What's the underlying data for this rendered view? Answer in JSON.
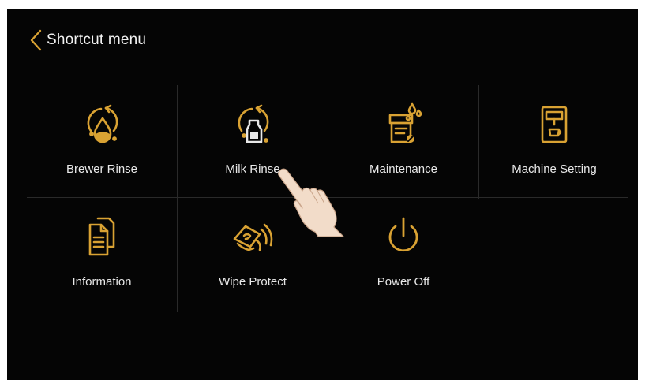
{
  "header": {
    "title": "Shortcut menu"
  },
  "colors": {
    "accent": "#d9a233",
    "background": "#050505",
    "text": "#e9e9e9"
  },
  "menu": {
    "items": [
      {
        "label": "Brewer Rinse",
        "icon": "brewer-rinse-icon"
      },
      {
        "label": "Milk Rinse",
        "icon": "milk-rinse-icon"
      },
      {
        "label": "Maintenance",
        "icon": "maintenance-icon"
      },
      {
        "label": "Machine Setting",
        "icon": "machine-setting-icon"
      },
      {
        "label": "Information",
        "icon": "information-icon"
      },
      {
        "label": "Wipe Protect",
        "icon": "wipe-protect-icon"
      },
      {
        "label": "Power Off",
        "icon": "power-off-icon"
      }
    ]
  }
}
